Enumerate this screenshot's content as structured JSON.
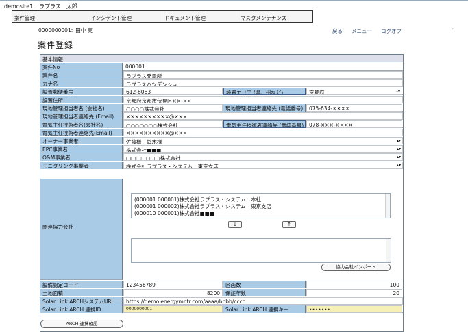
{
  "header": {
    "site": "demosite1:",
    "user": "ラプラス　太郎"
  },
  "menu": [
    "案件管理",
    "インシデント管理",
    "ドキュメント管理",
    "マスタメンテナンス"
  ],
  "subheader": {
    "code": "0000000001:",
    "name": "田中 実"
  },
  "links": {
    "back": "戻る",
    "menu": "メニュー",
    "logoff": "ログオフ"
  },
  "dash": "–",
  "page_title": "案件登録",
  "form": {
    "section": "基本情報",
    "case_no": {
      "label": "案件No",
      "value": "000001"
    },
    "case_name": {
      "label": "案件名",
      "value": "ラプラス発電所"
    },
    "kana": {
      "label": "カナ名",
      "value": "ラプラスハツデンショ"
    },
    "postal": {
      "label": "設置郵便番号",
      "value": "612-8083"
    },
    "area": {
      "label": "設置エリア (県、州など)",
      "value": "京都府"
    },
    "address": {
      "label": "設置住所",
      "value": "京都府京都市伏見区××-××"
    },
    "site_manager": {
      "label": "現地管理担当者名 (会社名)",
      "value": "○○○○株式会社"
    },
    "site_manager_tel": {
      "label": "現地管理担当者連絡先 (電話番号)",
      "value": "075-634-××××"
    },
    "site_manager_email": {
      "label": "現地管理担当者連絡先 (Email)",
      "value": "××××××××××@×××"
    },
    "engineer": {
      "label": "電気主任技術者名(会社名)",
      "value": "○○○○○○○株式会社"
    },
    "engineer_tel": {
      "label": "電気主任技術者連絡先 (電話番号)",
      "value": "078-×××-××××"
    },
    "engineer_email": {
      "label": "電気主任技術者連絡先(Email)",
      "value": "××××××××××@×××"
    },
    "owner": {
      "label": "オーナー事業者",
      "value": "佐藤様　鈴木様"
    },
    "epc": {
      "label": "EPC事業者",
      "value": "株式会社■■■"
    },
    "om": {
      "label": "O&M事業者",
      "value": "□□□□□□□株式会社"
    },
    "monitoring": {
      "label": "モニタリング事業者",
      "value": "株式会社ラプラス・システム　東京支店"
    },
    "related": {
      "label": "関連協力会社",
      "partners": [
        "(000001 000001)株式会社ラプラス・システム　本社",
        "(000001 000002)株式会社ラプラス・システム　東京支店",
        "(000010 000001)株式会社■■■"
      ],
      "down": "↓",
      "up": "↑",
      "import_label": "協力会社インポート"
    },
    "cert_code": {
      "label": "設備認定コード",
      "value": "123456789"
    },
    "section_count": {
      "label": "区画数",
      "value": "100"
    },
    "land_area": {
      "label": "土地面積",
      "value": "8200"
    },
    "warranty": {
      "label": "保証年数",
      "value": "20"
    },
    "arch_url": {
      "label": "Solar Link ARCHシステムURL",
      "value": "https://demo.energymntr.com/aaaa/bbbb/cccc"
    },
    "arch_id": {
      "label": "Solar Link ARCH 連携ID",
      "value": "0000000001"
    },
    "arch_key": {
      "label": "Solar Link ARCH 連携キー",
      "value": "•••••••"
    }
  },
  "arch_confirm": "ARCH 連携確認"
}
